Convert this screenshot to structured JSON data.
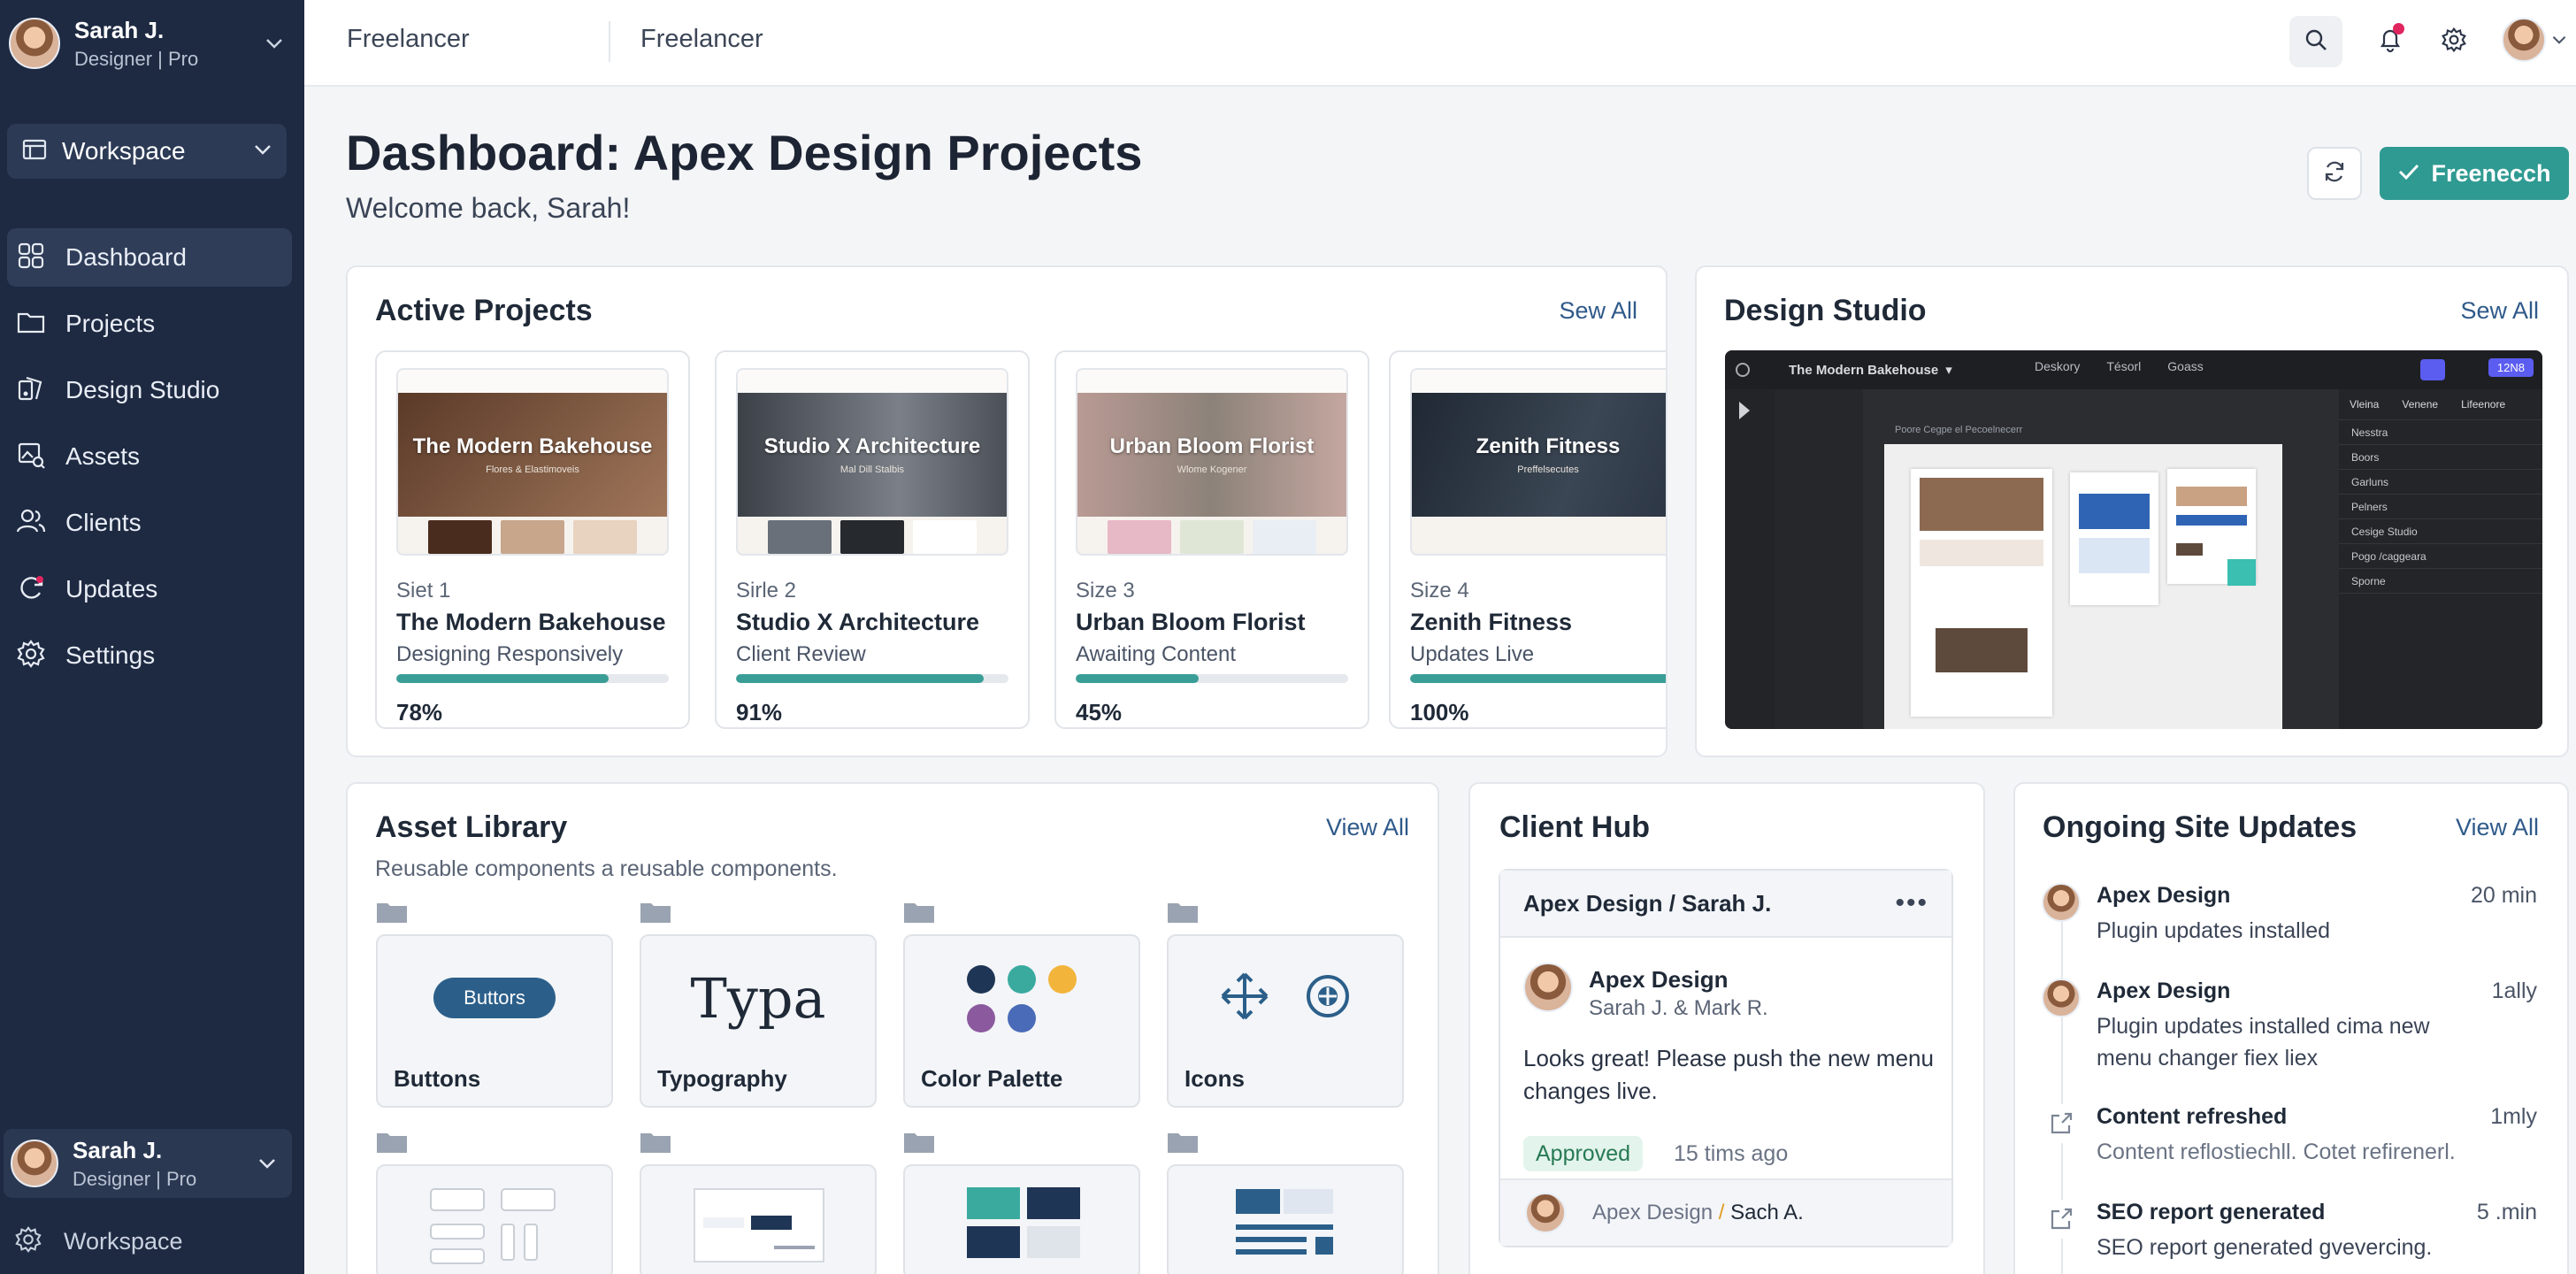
{
  "user": {
    "name": "Sarah J.",
    "role": "Designer | Pro"
  },
  "sidebar": {
    "workspace_label": "Workspace",
    "items": [
      {
        "label": "Dashboard",
        "icon": "grid-icon",
        "active": true
      },
      {
        "label": "Projects",
        "icon": "folder-icon",
        "active": false
      },
      {
        "label": "Design Studio",
        "icon": "palette-icon",
        "active": false
      },
      {
        "label": "Assets",
        "icon": "image-icon",
        "active": false
      },
      {
        "label": "Clients",
        "icon": "users-icon",
        "active": false
      },
      {
        "label": "Updates",
        "icon": "sync-icon",
        "active": false
      },
      {
        "label": "Settings",
        "icon": "gear-icon",
        "active": false
      }
    ],
    "bottom_workspace_label": "Workspace"
  },
  "topbar": {
    "crumb_1": "Freelancer",
    "crumb_2": "Freelancer"
  },
  "header": {
    "title": "Dashboard: Apex Design Projects",
    "subtitle": "Welcome back, Sarah!",
    "primary_button": "Freenecch"
  },
  "active_projects": {
    "title": "Active Projects",
    "link": "Sew All",
    "projects": [
      {
        "size": "Siet 1",
        "name": "The Modern Bakehouse",
        "status": "Designing Responsively",
        "progress_text": "78%",
        "progress": 0.78,
        "hero": "The Modern Bakehouse",
        "tag": "Flores & Elastimoveis",
        "hero_color": "#6d4a35",
        "tiles": [
          "#4a2c1f",
          "#c7a68c",
          "#e8d2c0"
        ]
      },
      {
        "size": "Sirle 2",
        "name": "Studio X Architecture",
        "status": "Client Review",
        "progress_text": "91%",
        "progress": 0.91,
        "hero": "Studio X Architecture",
        "tag": "Mal Dill Stalbis",
        "hero_color": "#4b5057",
        "tiles": [
          "#6a7079",
          "#26292d",
          "#ffffff"
        ]
      },
      {
        "size": "Size 3",
        "name": "Urban Bloom Florist",
        "status": "Awaiting Content",
        "progress_text": "45%",
        "progress": 0.45,
        "hero": "Urban Bloom Florist",
        "tag": "Wlome Kogener",
        "hero_color": "#8c8279",
        "tiles": [
          "#e7b8c6",
          "#dfe6d6",
          "#e9eef4"
        ]
      },
      {
        "size": "Size 4",
        "name": "Zenith Fitness",
        "status": "Updates Live",
        "progress_text": "100%",
        "progress": 1.0,
        "hero": "Zenith Fitness",
        "tag": "Preffelsecutes",
        "hero_color": "#2a3442",
        "tiles": [
          "#ffffff",
          "#ffffff",
          "#ffffff"
        ]
      }
    ]
  },
  "design_studio": {
    "title": "Design Studio",
    "link": "Sew All",
    "file_name": "The Modern Bakehouse",
    "tabs": [
      "Deskory",
      "Tésorl",
      "Goass"
    ],
    "badge": "12N8",
    "panel_tabs": [
      "Vleina",
      "Venene",
      "Lifeenore"
    ],
    "panel_rows": [
      "Nesstra",
      "Boors",
      "Garluns",
      "Pelners",
      "Cesige Studio",
      "Pogo /caggeara",
      "Sporne"
    ],
    "canvas_label": "Poore Cegpe el Pecoelnecerr"
  },
  "asset_library": {
    "title": "Asset Library",
    "subtitle": "Reusable components a reusable components.",
    "link": "View All",
    "assets": [
      {
        "name": "Buttons",
        "preview_label": "Buttors"
      },
      {
        "name": "Typography",
        "preview_label": "Typa"
      },
      {
        "name": "Color Palette",
        "colors": [
          "#1f3556",
          "#3aaa9f",
          "#f2b43b",
          "#8b5a9e",
          "#4a6bb8"
        ]
      },
      {
        "name": "Icons",
        "icons": [
          "move-icon",
          "globe-icon"
        ]
      }
    ]
  },
  "client_hub": {
    "title": "Client Hub",
    "thread": "Apex Design / Sarah J.",
    "sender": "Apex Design",
    "recipients": "Sarah J. & Mark R.",
    "message": "Looks great! Please push the new menu changes live.",
    "badge": "Approved",
    "time": "15 tims ago",
    "footer_from": "Apex Design",
    "footer_to": "Sach A."
  },
  "updates": {
    "title": "Ongoing Site Updates",
    "link": "View All",
    "items": [
      {
        "title": "Apex Design",
        "desc": "Plugin updates installed",
        "time": "20 min",
        "kind": "avatar"
      },
      {
        "title": "Apex Design",
        "desc": "Plugin updates installed cima new menu changer fiex liex",
        "time": "1ally",
        "kind": "avatar"
      },
      {
        "title": "Content refreshed",
        "desc": "Content reflostiechll. Cotet refirenerl.",
        "time": "1mly",
        "kind": "icon"
      },
      {
        "title": "SEO report generated",
        "desc": "SEO report generated gvevercing.",
        "time": "5 .min",
        "kind": "icon"
      }
    ]
  },
  "colors": {
    "sidebar": "#1e2a42",
    "accent": "#2f9a92",
    "link": "#2f5a8a",
    "notification": "#e0245e"
  }
}
